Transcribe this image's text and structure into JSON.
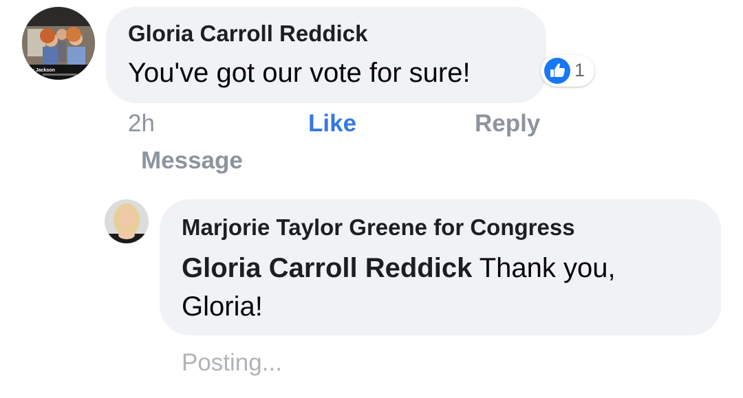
{
  "comment": {
    "author": "Gloria Carroll Reddick",
    "text": "You've got our vote for sure!",
    "reaction_count": "1",
    "reaction_icon": "like-icon",
    "reaction_color": "#1877f2",
    "time": "2h",
    "like_label": "Like",
    "reply_label": "Reply",
    "message_label": "Message",
    "avatar_caption": "y Jackson"
  },
  "reply": {
    "author": "Marjorie Taylor Greene for Congress",
    "mention": "Gloria Carroll Reddick",
    "text": " Thank you, Gloria!",
    "status": "Posting..."
  },
  "colors": {
    "bubble": "#f0f2f5",
    "like_blue": "#3578e5",
    "meta_gray": "#8d949e"
  }
}
